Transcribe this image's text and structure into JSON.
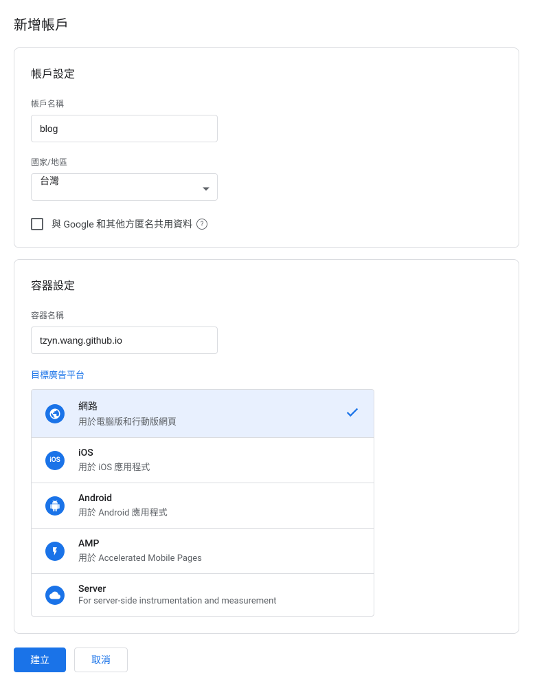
{
  "page": {
    "title": "新增帳戶"
  },
  "accountSettings": {
    "title": "帳戶設定",
    "nameLabel": "帳戶名稱",
    "nameValue": "blog",
    "countryLabel": "國家/地區",
    "countryValue": "台灣",
    "shareDataLabel": "與 Google 和其他方匿名共用資料"
  },
  "containerSettings": {
    "title": "容器設定",
    "nameLabel": "容器名稱",
    "nameValue": "tzyn.wang.github.io",
    "platformLabel": "目標廣告平台",
    "platforms": [
      {
        "id": "web",
        "title": "網路",
        "desc": "用於電腦版和行動版網頁",
        "selected": true,
        "iconColor": "#1a73e8"
      },
      {
        "id": "ios",
        "title": "iOS",
        "desc": "用於 iOS 應用程式",
        "selected": false,
        "iconColor": "#1a73e8"
      },
      {
        "id": "android",
        "title": "Android",
        "desc": "用於 Android 應用程式",
        "selected": false,
        "iconColor": "#1a73e8"
      },
      {
        "id": "amp",
        "title": "AMP",
        "desc": "用於 Accelerated Mobile Pages",
        "selected": false,
        "iconColor": "#1a73e8"
      },
      {
        "id": "server",
        "title": "Server",
        "desc": "For server-side instrumentation and measurement",
        "selected": false,
        "iconColor": "#1a73e8"
      }
    ]
  },
  "buttons": {
    "create": "建立",
    "cancel": "取消"
  }
}
